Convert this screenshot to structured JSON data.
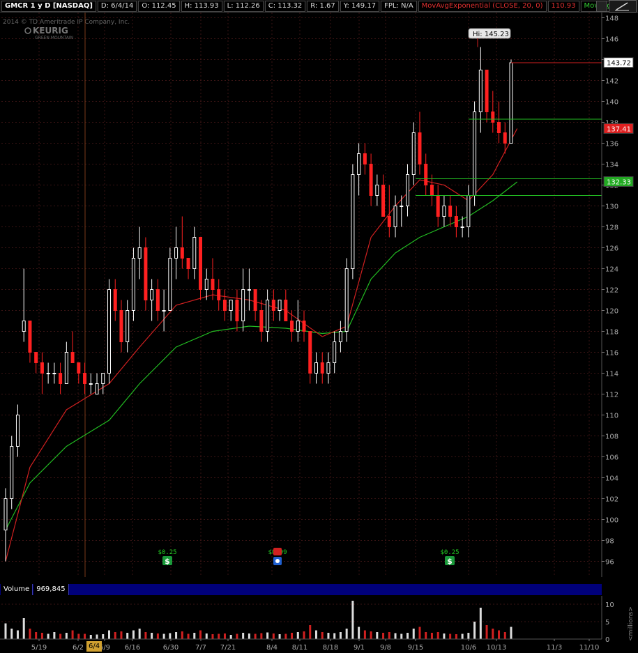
{
  "toolbar": {
    "symbol": "GMCR 1 y D [NASDAQ]",
    "date": "D: 6/4/14",
    "open": "O: 112.45",
    "high": "H: 113.93",
    "low": "L: 112.26",
    "close": "C: 113.32",
    "range": "R: 1.67",
    "year_high": "Y: 149.17",
    "fpl": "FPL: N/A",
    "ema20_label": "MovAvgExponential (CLOSE, 20, 0)",
    "ema20_value": "110.93",
    "ema50_label": "MovAvg..."
  },
  "watermark": {
    "copyright": "2014 © TD Ameritrade IP Company, Inc.",
    "brand": "KEURIG",
    "brand_sub": "GREEN MOUNTAIN"
  },
  "colors": {
    "up": "#ffffff",
    "down": "#ff2020",
    "ema20": "#d02020",
    "ema50": "#22bb22",
    "grid": "#3a1414",
    "axis_text": "#aaaaaa",
    "volume": "#d02020"
  },
  "hi_label": "Hi: 145.23",
  "price_tags": [
    {
      "value": "143.72",
      "bg": "#ffffff",
      "fg": "#000000"
    },
    {
      "value": "137.41",
      "bg": "#e02020",
      "fg": "#ffffff"
    },
    {
      "value": "132.33",
      "bg": "#22aa22",
      "fg": "#ffffff"
    }
  ],
  "events": [
    {
      "label": "$0.25",
      "icon": "dividend-icon",
      "date": "5/27"
    },
    {
      "label": "$0.99",
      "icon": "earnings-icon",
      "date": "8/4"
    },
    {
      "label": "$0.25",
      "icon": "dividend-icon",
      "date": "10/1"
    }
  ],
  "volume_header": {
    "label": "Volume",
    "value": "969,845",
    "unit": "<millions>"
  },
  "cursor_date": "6/4",
  "chart_data": {
    "type": "candlestick",
    "ylim": [
      94.5,
      148.5
    ],
    "y_ticks": [
      96,
      98,
      100,
      102,
      104,
      106,
      108,
      110,
      112,
      114,
      116,
      118,
      120,
      122,
      124,
      126,
      128,
      130,
      132,
      134,
      136,
      138,
      140,
      142,
      144,
      146,
      148
    ],
    "x_ticks": [
      "5/19",
      "6/2",
      "6/9",
      "6/16",
      "6/30",
      "7/7",
      "7/21",
      "8/4",
      "8/11",
      "8/18",
      "9/1",
      "9/8",
      "9/15",
      "10/6",
      "10/13",
      "11/3",
      "11/10"
    ],
    "volume_ticks": [
      0,
      5,
      10
    ],
    "candles": [
      [
        99,
        103,
        96,
        102
      ],
      [
        102,
        108,
        101,
        107
      ],
      [
        107,
        111,
        106,
        110
      ],
      [
        118,
        124,
        117,
        119
      ],
      [
        119,
        119,
        115,
        116
      ],
      [
        116,
        116,
        114,
        115
      ],
      [
        115,
        116,
        112,
        114
      ],
      [
        114,
        115,
        113,
        114
      ],
      [
        114,
        115,
        113,
        114
      ],
      [
        114,
        115,
        112,
        113
      ],
      [
        113,
        117,
        113,
        116
      ],
      [
        116,
        118,
        115,
        115
      ],
      [
        115,
        115,
        113,
        114
      ],
      [
        114,
        115,
        112,
        113
      ],
      [
        113,
        114,
        112,
        113
      ],
      [
        112,
        114,
        112,
        113
      ],
      [
        113,
        114,
        112,
        114
      ],
      [
        114,
        123,
        113,
        122
      ],
      [
        122,
        123,
        119,
        120
      ],
      [
        120,
        121,
        116,
        117
      ],
      [
        117,
        121,
        116,
        120
      ],
      [
        120,
        126,
        119,
        125
      ],
      [
        125,
        128,
        123,
        126
      ],
      [
        126,
        127,
        120,
        121
      ],
      [
        121,
        123,
        119,
        122
      ],
      [
        122,
        123,
        119,
        120
      ],
      [
        120,
        122,
        118,
        120
      ],
      [
        120,
        126,
        120,
        125
      ],
      [
        125,
        128,
        123,
        126
      ],
      [
        126,
        129,
        124,
        125
      ],
      [
        125,
        125,
        123,
        124
      ],
      [
        124,
        128,
        123,
        127
      ],
      [
        127,
        127,
        121,
        122
      ],
      [
        122,
        124,
        121,
        123
      ],
      [
        123,
        125,
        121,
        122
      ],
      [
        122,
        123,
        120,
        121
      ],
      [
        121,
        122,
        119,
        120
      ],
      [
        120,
        121,
        119,
        121
      ],
      [
        121,
        122,
        118,
        119
      ],
      [
        119,
        124,
        118,
        122
      ],
      [
        122,
        124,
        120,
        122
      ],
      [
        122,
        122,
        119,
        120
      ],
      [
        120,
        121,
        117,
        118
      ],
      [
        118,
        122,
        117,
        121
      ],
      [
        121,
        122,
        119,
        120
      ],
      [
        120,
        121,
        119,
        121
      ],
      [
        121,
        122,
        119,
        119
      ],
      [
        119,
        120,
        117,
        118
      ],
      [
        118,
        121,
        117,
        119
      ],
      [
        119,
        120,
        117,
        118
      ],
      [
        118,
        118,
        113,
        114
      ],
      [
        114,
        116,
        113,
        115
      ],
      [
        115,
        116,
        113,
        114
      ],
      [
        114,
        116,
        113,
        115
      ],
      [
        115,
        118,
        114,
        117
      ],
      [
        117,
        119,
        116,
        118
      ],
      [
        118,
        125,
        117,
        124
      ],
      [
        124,
        134,
        123,
        133
      ],
      [
        133,
        136,
        131,
        135
      ],
      [
        135,
        136,
        133,
        134
      ],
      [
        134,
        135,
        130,
        131
      ],
      [
        131,
        133,
        130,
        132
      ],
      [
        132,
        133,
        129,
        129
      ],
      [
        129,
        132,
        127,
        128
      ],
      [
        128,
        131,
        127,
        130
      ],
      [
        130,
        131,
        128,
        130
      ],
      [
        130,
        134,
        129,
        133
      ],
      [
        133,
        138,
        132,
        137
      ],
      [
        137,
        139,
        133,
        134
      ],
      [
        134,
        135,
        131,
        132
      ],
      [
        132,
        133,
        130,
        131
      ],
      [
        131,
        132,
        128,
        129
      ],
      [
        129,
        131,
        128,
        130
      ],
      [
        130,
        131,
        128,
        129
      ],
      [
        129,
        130,
        127,
        128
      ],
      [
        128,
        129,
        127,
        128
      ],
      [
        128,
        132,
        127,
        131
      ],
      [
        131,
        140,
        130,
        139
      ],
      [
        139,
        145.2,
        137,
        143
      ],
      [
        143,
        143,
        138,
        139
      ],
      [
        139,
        141,
        137,
        138
      ],
      [
        138,
        140,
        136,
        137
      ],
      [
        137,
        138,
        135,
        136
      ],
      [
        136,
        144,
        136,
        143.7
      ]
    ],
    "ema20": [
      [
        0,
        96
      ],
      [
        4,
        105
      ],
      [
        10,
        110.5
      ],
      [
        17,
        113
      ],
      [
        22,
        116.5
      ],
      [
        28,
        120.5
      ],
      [
        34,
        121.5
      ],
      [
        40,
        121
      ],
      [
        46,
        120
      ],
      [
        52,
        117.5
      ],
      [
        56,
        118.5
      ],
      [
        60,
        127
      ],
      [
        64,
        130
      ],
      [
        68,
        132.5
      ],
      [
        72,
        132
      ],
      [
        76,
        130.5
      ],
      [
        80,
        133
      ],
      [
        84,
        137.4
      ]
    ],
    "ema50": [
      [
        0,
        99
      ],
      [
        4,
        103.5
      ],
      [
        10,
        107
      ],
      [
        17,
        109.5
      ],
      [
        22,
        113
      ],
      [
        28,
        116.5
      ],
      [
        34,
        118
      ],
      [
        40,
        118.5
      ],
      [
        46,
        118.3
      ],
      [
        52,
        117.8
      ],
      [
        56,
        118
      ],
      [
        60,
        123
      ],
      [
        64,
        125.5
      ],
      [
        68,
        127
      ],
      [
        72,
        128
      ],
      [
        76,
        129
      ],
      [
        80,
        130.5
      ],
      [
        84,
        132.3
      ]
    ],
    "volume": [
      4.5,
      3,
      2.5,
      6,
      3,
      2,
      1.8,
      1.5,
      2,
      1.5,
      1.8,
      2.5,
      1.5,
      1.5,
      1.2,
      1.3,
      1.4,
      2.5,
      2,
      2.2,
      1.8,
      2.5,
      3,
      2,
      1.8,
      1.6,
      1.5,
      1.7,
      2,
      2.2,
      1.5,
      1.8,
      2.5,
      1.6,
      1.4,
      1.5,
      1.6,
      1.2,
      1.5,
      1.8,
      1.6,
      1.5,
      1.7,
      1.9,
      1.6,
      1.4,
      1.5,
      1.8,
      2,
      2.2,
      4,
      2.5,
      2,
      1.8,
      1.7,
      2,
      3,
      11,
      3.5,
      2.5,
      2.2,
      2,
      1.8,
      2,
      1.7,
      1.5,
      1.8,
      3,
      3.5,
      2,
      1.8,
      2,
      1.6,
      1.5,
      1.4,
      1.5,
      1.8,
      5,
      9,
      4,
      3,
      2.5,
      2,
      3.5
    ]
  }
}
